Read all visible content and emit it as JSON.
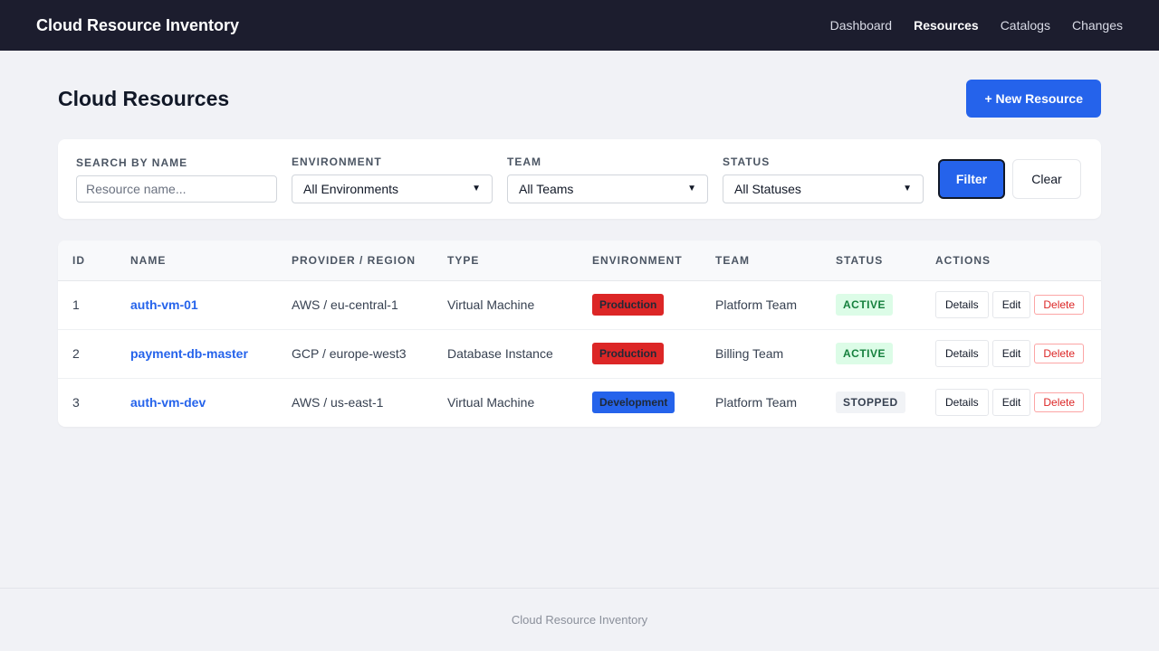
{
  "app": {
    "title": "Cloud Resource Inventory"
  },
  "nav": {
    "items": [
      "Dashboard",
      "Resources",
      "Catalogs",
      "Changes"
    ],
    "active": "Resources"
  },
  "page": {
    "title": "Cloud Resources",
    "new_button": "+ New Resource"
  },
  "filters": {
    "search_label": "Search by name",
    "search_placeholder": "Resource name...",
    "search_value": "",
    "environment_label": "Environment",
    "environment_value": "All Environments",
    "team_label": "Team",
    "team_value": "All Teams",
    "status_label": "Status",
    "status_value": "All Statuses",
    "filter_button": "Filter",
    "clear_button": "Clear"
  },
  "table": {
    "headers": [
      "ID",
      "Name",
      "Provider / Region",
      "Type",
      "Environment",
      "Team",
      "Status",
      "Actions"
    ],
    "rows": [
      {
        "id": "1",
        "name": "auth-vm-01",
        "provider_region": "AWS / eu-central-1",
        "type": "Virtual Machine",
        "environment": "Production",
        "team": "Platform Team",
        "status": "ACTIVE"
      },
      {
        "id": "2",
        "name": "payment-db-master",
        "provider_region": "GCP / europe-west3",
        "type": "Database Instance",
        "environment": "Production",
        "team": "Billing Team",
        "status": "ACTIVE"
      },
      {
        "id": "3",
        "name": "auth-vm-dev",
        "provider_region": "AWS / us-east-1",
        "type": "Virtual Machine",
        "environment": "Development",
        "team": "Platform Team",
        "status": "STOPPED"
      }
    ],
    "actions": {
      "details": "Details",
      "edit": "Edit",
      "delete": "Delete"
    }
  },
  "colors": {
    "navbar_bg": "#1c1d2e",
    "accent": "#2563eb",
    "production": "#dc2626",
    "development": "#2563eb",
    "active_bg": "#dcfce7",
    "active_text": "#15803d",
    "stopped_bg": "#f1f3f6",
    "stopped_text": "#374151"
  },
  "footer": {
    "text": "Cloud Resource Inventory"
  }
}
